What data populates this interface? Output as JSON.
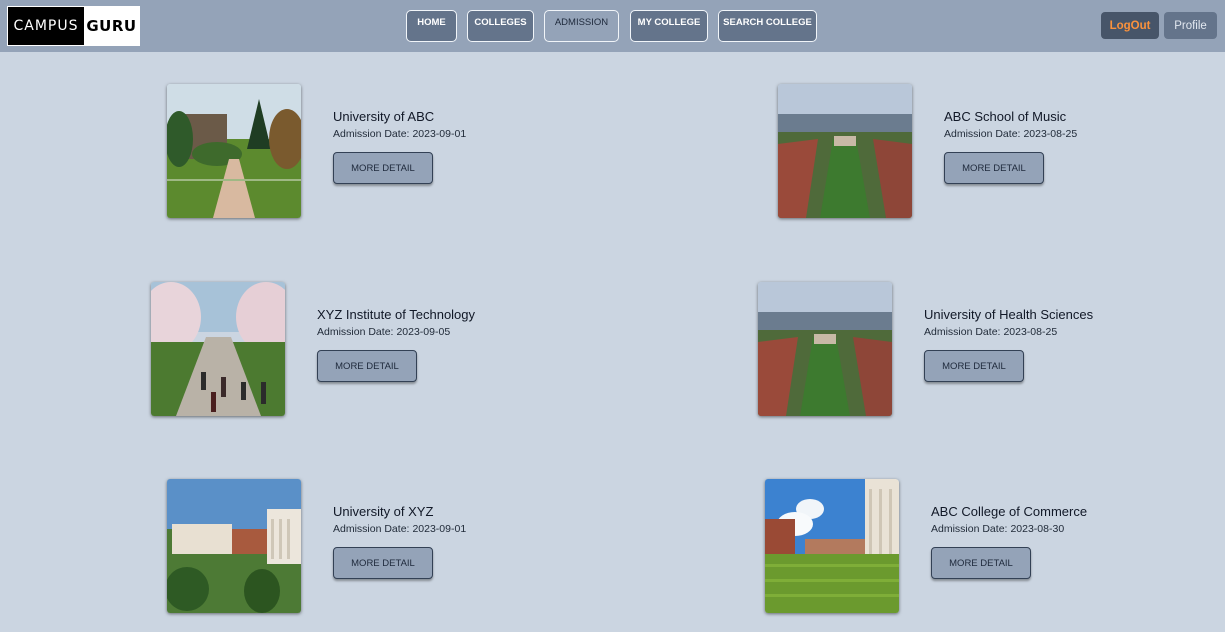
{
  "brand": {
    "left": "CAMPUS",
    "right": "GURU"
  },
  "nav": {
    "items": [
      {
        "label": "HOME"
      },
      {
        "label": "COLLEGES"
      },
      {
        "label": "ADMISSION"
      },
      {
        "label": "MY COLLEGE"
      },
      {
        "label": "SEARCH COLLEGE"
      }
    ],
    "active": "ADMISSION",
    "logout": "LogOut",
    "profile": "Profile"
  },
  "colleges": [
    {
      "name": "University of ABC",
      "date_label": "Admission Date:",
      "date": "2023-09-01",
      "button": "MORE DETAIL",
      "image": "campus-walkway-photo"
    },
    {
      "name": "ABC School of Music",
      "date_label": "Admission Date:",
      "date": "2023-08-25",
      "button": "MORE DETAIL",
      "image": "aerial-campus-photo"
    },
    {
      "name": "XYZ Institute of Technology",
      "date_label": "Admission Date:",
      "date": "2023-09-05",
      "button": "MORE DETAIL",
      "image": "cherry-blossom-quad-photo"
    },
    {
      "name": "University of Health Sciences",
      "date_label": "Admission Date:",
      "date": "2023-08-25",
      "button": "MORE DETAIL",
      "image": "aerial-campus-photo"
    },
    {
      "name": "University of XYZ",
      "date_label": "Admission Date:",
      "date": "2023-09-01",
      "button": "MORE DETAIL",
      "image": "campus-buildings-photo"
    },
    {
      "name": "ABC College of Commerce",
      "date_label": "Admission Date:",
      "date": "2023-08-30",
      "button": "MORE DETAIL",
      "image": "campus-lawn-photo"
    }
  ],
  "colors": {
    "page_bg": "#cbd5e1",
    "nav_bg": "#94a3b8",
    "button_bg": "#64748b",
    "logout_text": "#fb923c"
  }
}
